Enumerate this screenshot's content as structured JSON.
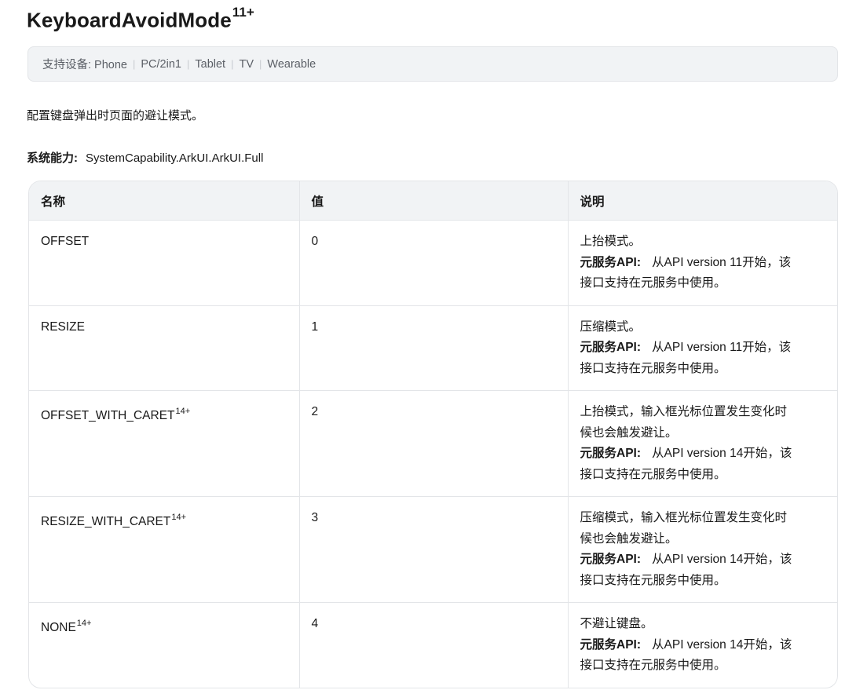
{
  "heading": {
    "title": "KeyboardAvoidMode",
    "version": "11+"
  },
  "devices": {
    "label": "支持设备: Phone",
    "items": [
      "PC/2in1",
      "Tablet",
      "TV",
      "Wearable"
    ]
  },
  "description": "配置键盘弹出时页面的避让模式。",
  "syscap": {
    "label": "系统能力:",
    "value": "SystemCapability.ArkUI.ArkUI.Full"
  },
  "table": {
    "headers": [
      "名称",
      "值",
      "说明"
    ],
    "rows": [
      {
        "name": "OFFSET",
        "sup": "",
        "value": "0",
        "desc": [
          "上抬模式。"
        ],
        "note_label": "元服务API:",
        "note_lines": [
          "从API version 11开始，该",
          "接口支持在元服务中使用。"
        ]
      },
      {
        "name": "RESIZE",
        "sup": "",
        "value": "1",
        "desc": [
          "压缩模式。"
        ],
        "note_label": "元服务API:",
        "note_lines": [
          "从API version 11开始，该",
          "接口支持在元服务中使用。"
        ]
      },
      {
        "name": "OFFSET_WITH_CARET",
        "sup": "14+",
        "value": "2",
        "desc": [
          "上抬模式，输入框光标位置发生变化时",
          "候也会触发避让。"
        ],
        "note_label": "元服务API:",
        "note_lines": [
          "从API version 14开始，该",
          "接口支持在元服务中使用。"
        ]
      },
      {
        "name": "RESIZE_WITH_CARET",
        "sup": "14+",
        "value": "3",
        "desc": [
          "压缩模式，输入框光标位置发生变化时",
          "候也会触发避让。"
        ],
        "note_label": "元服务API:",
        "note_lines": [
          "从API version 14开始，该",
          "接口支持在元服务中使用。"
        ]
      },
      {
        "name": "NONE",
        "sup": "14+",
        "value": "4",
        "desc": [
          "不避让键盘。"
        ],
        "note_label": "元服务API:",
        "note_lines": [
          "从API version 14开始，该",
          "接口支持在元服务中使用。"
        ]
      }
    ]
  }
}
